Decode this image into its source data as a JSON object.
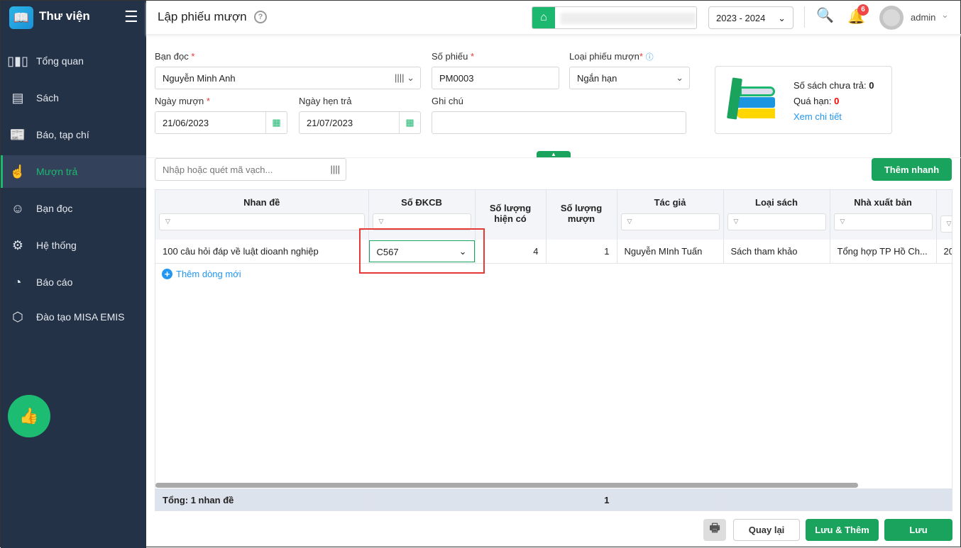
{
  "sidebar": {
    "app_name": "Thư viện",
    "items": [
      {
        "label": "Tổng quan",
        "icon": "chart-bars-icon"
      },
      {
        "label": "Sách",
        "icon": "book-icon"
      },
      {
        "label": "Báo, tạp chí",
        "icon": "newspaper-icon"
      },
      {
        "label": "Mượn trả",
        "icon": "borrow-icon",
        "active": true
      },
      {
        "label": "Bạn đọc",
        "icon": "reader-icon"
      },
      {
        "label": "Hệ thống",
        "icon": "gear-icon"
      },
      {
        "label": "Báo cáo",
        "icon": "pie-chart-icon"
      },
      {
        "label": "Đào tạo MISA EMIS",
        "icon": "cube-icon"
      }
    ]
  },
  "header": {
    "title": "Lập phiếu mượn",
    "school_year": "2023 - 2024",
    "notification_count": "6",
    "user": "admin"
  },
  "form": {
    "ban_doc": {
      "label": "Bạn đọc",
      "value": "Nguyễn Minh Anh"
    },
    "so_phieu": {
      "label": "Số phiếu",
      "value": "PM0003"
    },
    "loai_phieu": {
      "label": "Loại phiếu mượn",
      "value": "Ngắn hạn"
    },
    "ngay_muon": {
      "label": "Ngày mượn",
      "value": "21/06/2023"
    },
    "ngay_hen_tra": {
      "label": "Ngày hẹn trả",
      "value": "21/07/2023"
    },
    "ghi_chu": {
      "label": "Ghi chú",
      "value": ""
    },
    "barcode_placeholder": "Nhập hoặc quét mã vạch...",
    "quick_add": "Thêm nhanh"
  },
  "summary": {
    "unreturned_label": "Số sách chưa trả:",
    "unreturned": "0",
    "overdue_label": "Quá hạn:",
    "overdue": "0",
    "detail_link": "Xem chi tiết"
  },
  "table": {
    "columns": [
      "Nhan đề",
      "Số ĐKCB",
      "Số lượng hiện có",
      "Số lượng mượn",
      "Tác giả",
      "Loại sách",
      "Nhà xuất bản",
      ""
    ],
    "rows": [
      {
        "title": "100 câu hỏi đáp về luật dioanh nghiệp",
        "dkcb": "C567",
        "available": "4",
        "borrow": "1",
        "author": "Nguyễn MInh Tuấn",
        "type": "Sách tham khảo",
        "publisher": "Tổng hợp TP Hồ Ch...",
        "extra": "20"
      }
    ],
    "add_row": "Thêm dòng mới",
    "footer_label": "Tổng: 1 nhan đề",
    "footer_borrow": "1"
  },
  "actions": {
    "back": "Quay lại",
    "save_add": "Lưu & Thêm",
    "save": "Lưu"
  }
}
